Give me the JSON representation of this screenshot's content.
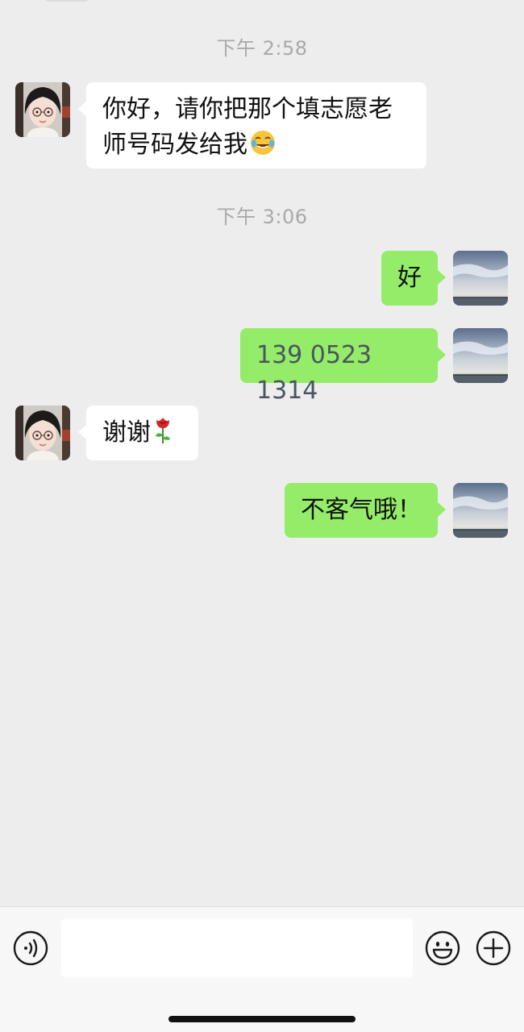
{
  "chat": {
    "timestamps": [
      "下午 2:58",
      "下午 3:06"
    ],
    "messages": [
      {
        "side": "in",
        "text_line1": "你好，请你把那个填志愿老",
        "text_line2": "师号码发给我",
        "emoji": "laughing-tears-emoji"
      },
      {
        "side": "out",
        "text": "好"
      },
      {
        "side": "out",
        "text": "139 0523 1314"
      },
      {
        "side": "in",
        "text": "谢谢",
        "emoji": "rose-emoji"
      },
      {
        "side": "out",
        "text": "不客气哦！"
      }
    ]
  },
  "input_bar": {
    "voice_icon": "voice-icon",
    "emoji_icon": "smiley-icon",
    "more_icon": "plus-circle-icon",
    "text_value": ""
  },
  "colors": {
    "background": "#ededed",
    "incoming_bubble": "#ffffff",
    "outgoing_bubble": "#95ec69",
    "timestamp": "#a9a9a9"
  }
}
